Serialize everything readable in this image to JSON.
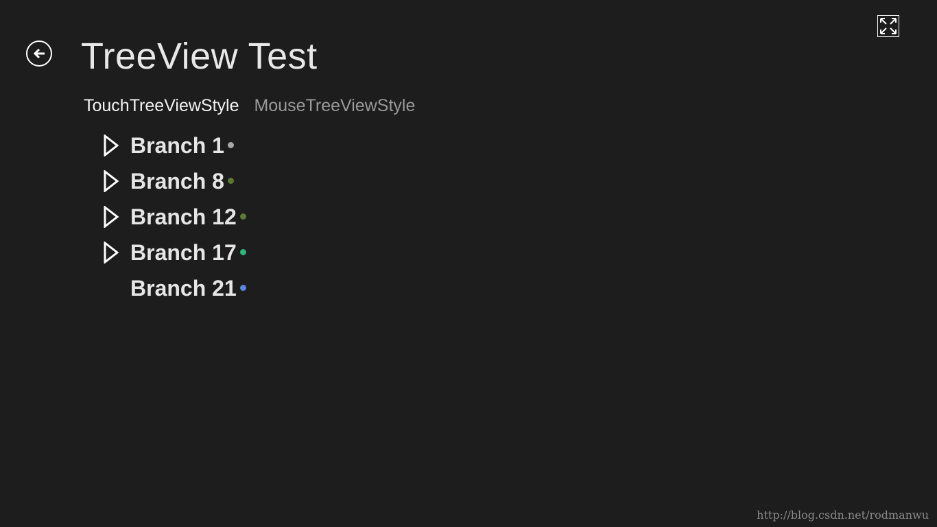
{
  "header": {
    "title": "TreeView Test",
    "back_icon": "back-arrow-circle-icon",
    "fullscreen_icon": "fullscreen-expand-icon"
  },
  "style_tabs": [
    {
      "label": "TouchTreeViewStyle",
      "active": true
    },
    {
      "label": "MouseTreeViewStyle",
      "active": false
    }
  ],
  "tree": {
    "nodes": [
      {
        "label": "Branch 1",
        "has_children": true,
        "dot_color": "#a8a8a8"
      },
      {
        "label": "Branch 8",
        "has_children": true,
        "dot_color": "#5a7a2e"
      },
      {
        "label": "Branch 12",
        "has_children": true,
        "dot_color": "#5e7a34"
      },
      {
        "label": "Branch 17",
        "has_children": true,
        "dot_color": "#2eb87a"
      },
      {
        "label": "Branch 21",
        "has_children": false,
        "dot_color": "#5b86e0"
      }
    ]
  },
  "watermark": "http://blog.csdn.net/rodmanwu",
  "colors": {
    "background": "#1d1d1d",
    "text": "#e6e6e6",
    "inactive_tab": "#9a9a9a"
  }
}
